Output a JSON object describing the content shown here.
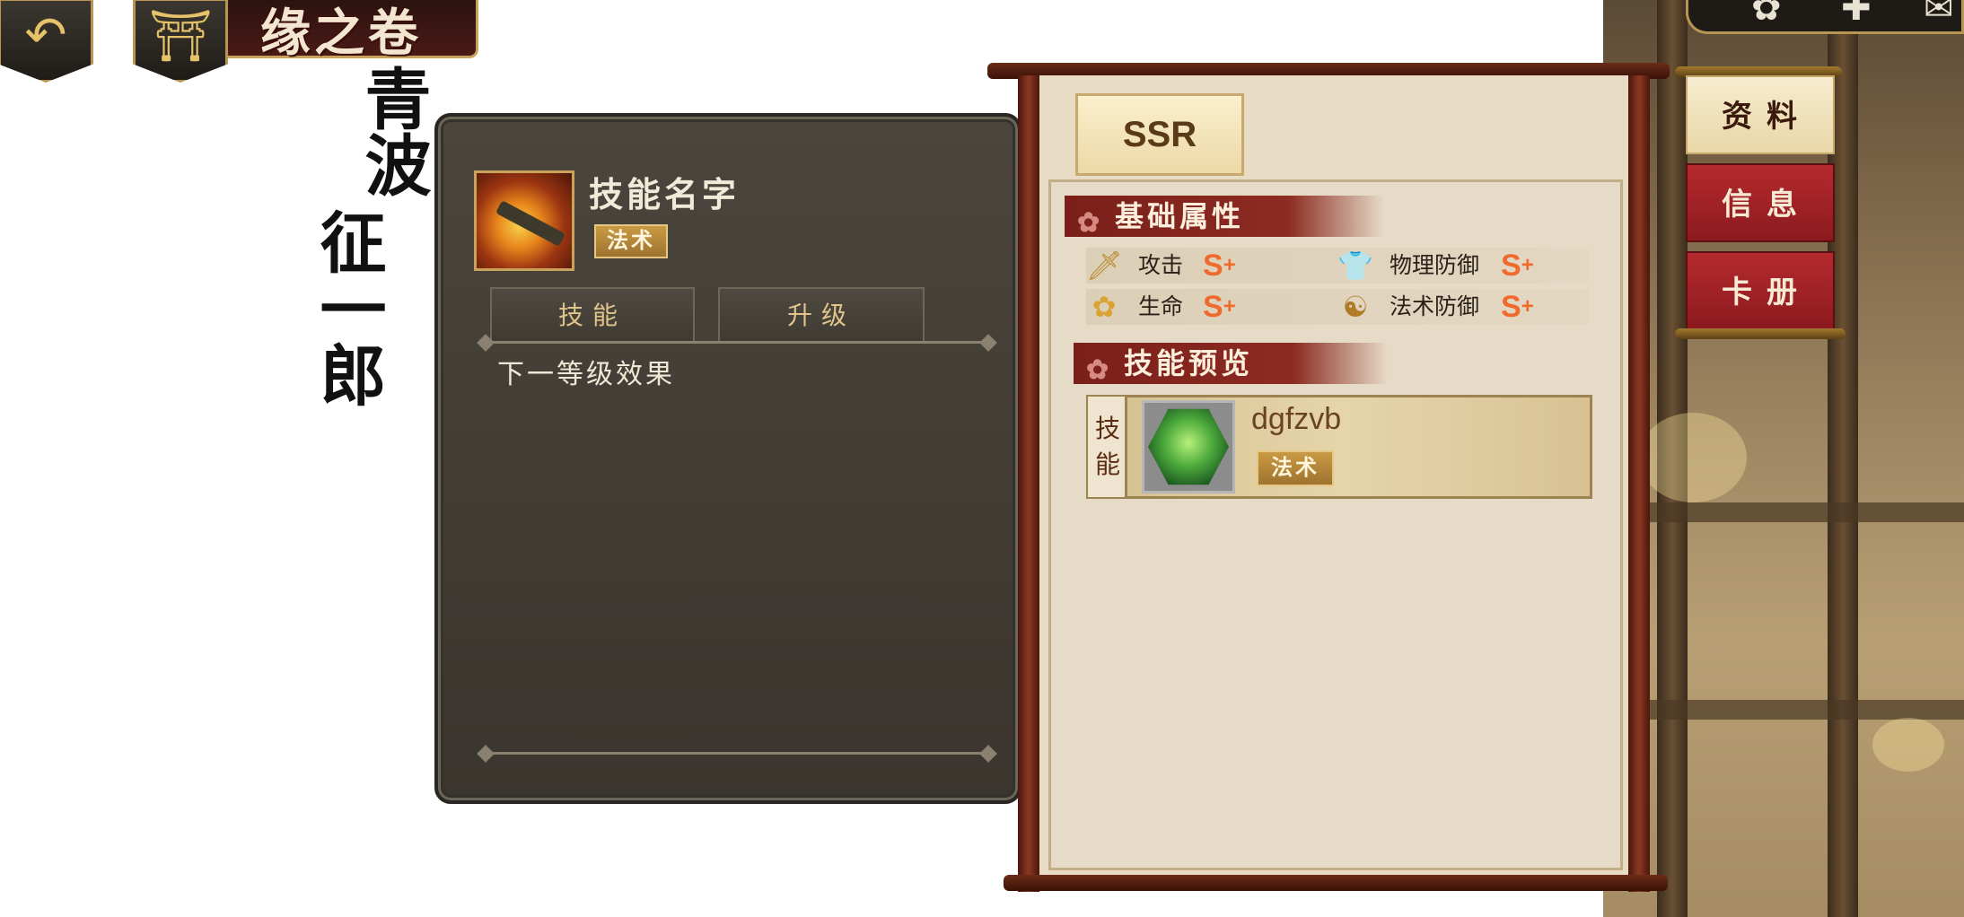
{
  "header": {
    "title": "缘之卷",
    "back_icon": "back-arrow-icon",
    "home_icon": "home-torii-icon"
  },
  "character": {
    "name_col1": "青波",
    "name_col2": "征一郎"
  },
  "skill_panel": {
    "skill_name": "技能名字",
    "type_badge": "法术",
    "tabs": [
      {
        "label": "技能"
      },
      {
        "label": "升级"
      }
    ],
    "next_level_label": "下一等级效果"
  },
  "scroll": {
    "rarity_tab": "SSR",
    "basic_attributes": {
      "title": "基础属性",
      "items": [
        {
          "icon": "sword-icon",
          "label": "攻击",
          "grade": "S",
          "plus": "+"
        },
        {
          "icon": "armor-icon",
          "label": "物理防御",
          "grade": "S",
          "plus": "+"
        },
        {
          "icon": "flower-hp-icon",
          "label": "生命",
          "grade": "S",
          "plus": "+"
        },
        {
          "icon": "yin-yang-icon",
          "label": "法术防御",
          "grade": "S",
          "plus": "+"
        }
      ]
    },
    "skill_preview": {
      "title": "技能预览",
      "side_label": "技能",
      "skill_name": "dgfzvb",
      "type_badge": "法术"
    }
  },
  "side_nav": {
    "items": [
      {
        "label": "资料",
        "active": true
      },
      {
        "label": "信息",
        "active": false
      },
      {
        "label": "卡册",
        "active": false
      }
    ]
  },
  "colors": {
    "accent_gold": "#c9a35c",
    "section_red": "#7b1f1a",
    "grade_orange": "#ef6a2c",
    "panel_dark": "#403b33"
  }
}
